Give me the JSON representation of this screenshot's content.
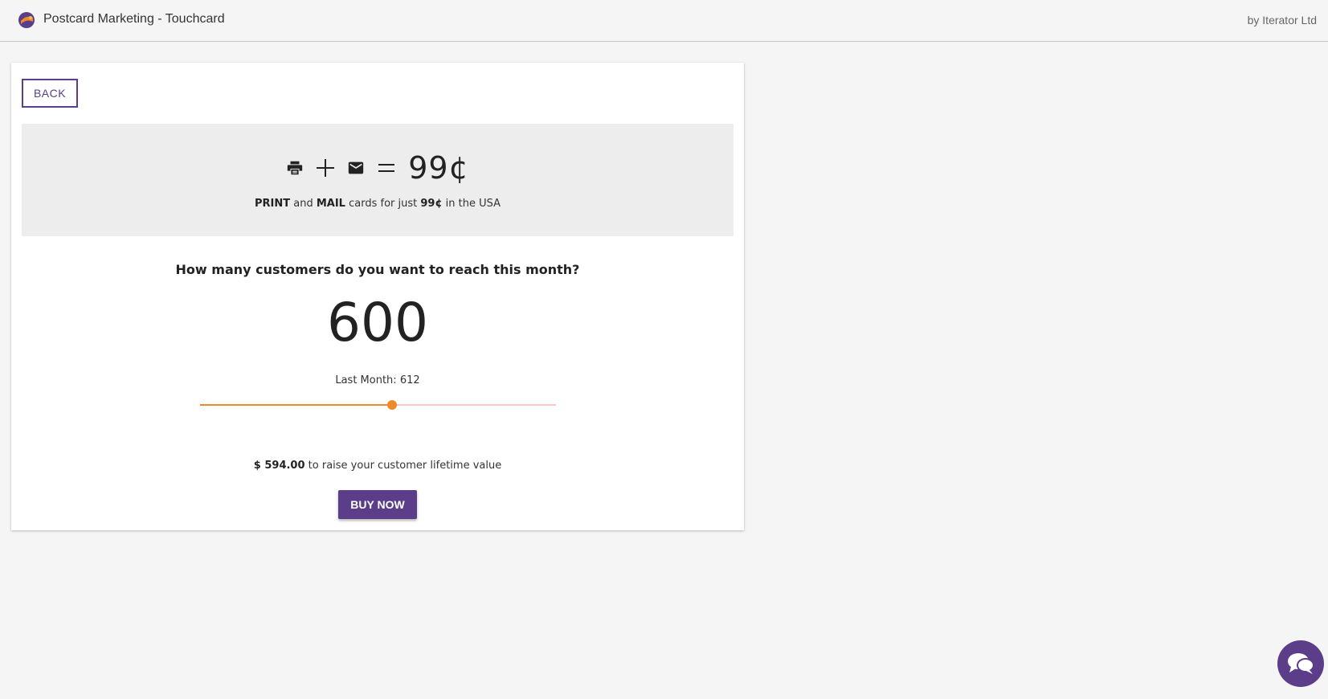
{
  "header": {
    "title": "Postcard Marketing - Touchcard",
    "byline": "by Iterator Ltd"
  },
  "back_button": {
    "label": "BACK"
  },
  "promo": {
    "icons": [
      "printer-icon",
      "plus-icon",
      "mail-icon",
      "equals-icon"
    ],
    "price": "99¢",
    "caption": {
      "print": "PRINT",
      "and": "and",
      "mail": "MAIL",
      "middle": "cards for just",
      "price": "99¢",
      "tail": "in the USA"
    }
  },
  "question": "How many customers do you want to reach this month?",
  "customer_count": "600",
  "last_month": "Last Month: 612",
  "slider": {
    "fraction": 0.54
  },
  "total": {
    "amount": "$ 594.00",
    "text": "to raise your customer lifetime value"
  },
  "buy_button": {
    "label": "BUY NOW"
  },
  "colors": {
    "brand_purple": "#5c3d8a",
    "slider_orange": "#ef8a2c",
    "slider_track": "#f8c8d0"
  },
  "chat": {
    "icon": "chat-bubbles-icon"
  }
}
